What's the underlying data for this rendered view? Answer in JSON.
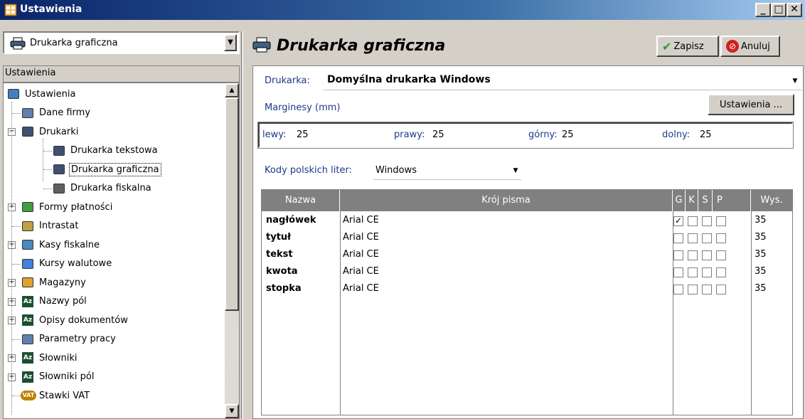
{
  "window": {
    "title": "Ustawienia",
    "min": "_",
    "max": "□",
    "close": "✕"
  },
  "left": {
    "combo_value": "Drukarka graficzna",
    "tree_header": "Ustawienia",
    "tree": [
      {
        "label": "Ustawienia",
        "icon": "tools-icon",
        "level": 0
      },
      {
        "label": "Dane firmy",
        "icon": "company-icon",
        "level": 1
      },
      {
        "label": "Drukarki",
        "icon": "printer-icon",
        "level": 1,
        "expander": "−"
      },
      {
        "label": "Drukarka tekstowa",
        "icon": "printer-icon",
        "level": 2
      },
      {
        "label": "Drukarka graficzna",
        "icon": "printer-icon",
        "level": 2,
        "selected": true
      },
      {
        "label": "Drukarka fiskalna",
        "icon": "fiscal-printer-icon",
        "level": 2
      },
      {
        "label": "Formy płatności",
        "icon": "payment-icon",
        "level": 1,
        "expander": "+"
      },
      {
        "label": "Intrastat",
        "icon": "intrastat-icon",
        "level": 1
      },
      {
        "label": "Kasy fiskalne",
        "icon": "cash-register-icon",
        "level": 1,
        "expander": "+"
      },
      {
        "label": "Kursy walutowe",
        "icon": "chart-icon",
        "level": 1
      },
      {
        "label": "Magazyny",
        "icon": "warehouse-icon",
        "level": 1,
        "expander": "+"
      },
      {
        "label": "Nazwy pól",
        "icon": "az-icon",
        "level": 1,
        "expander": "+"
      },
      {
        "label": "Opisy dokumentów",
        "icon": "az-icon",
        "level": 1,
        "expander": "+"
      },
      {
        "label": "Parametry pracy",
        "icon": "company-icon",
        "level": 1
      },
      {
        "label": "Słowniki",
        "icon": "az-icon",
        "level": 1,
        "expander": "+"
      },
      {
        "label": "Słowniki pól",
        "icon": "az-icon",
        "level": 1,
        "expander": "+"
      },
      {
        "label": "Stawki VAT",
        "icon": "vat-icon",
        "level": 1
      }
    ]
  },
  "right": {
    "title": "Drukarka graficzna",
    "save_label": "Zapisz",
    "cancel_label": "Anuluj",
    "printer_label": "Drukarka:",
    "printer_value": "Domyślna drukarka Windows",
    "margins_label": "Marginesy (mm)",
    "settings_button": "Ustawienia ...",
    "margins": {
      "left_label": "lewy:",
      "left_value": "25",
      "right_label": "prawy:",
      "right_value": "25",
      "top_label": "górny:",
      "top_value": "25",
      "bottom_label": "dolny:",
      "bottom_value": "25"
    },
    "codes_label": "Kody polskich liter:",
    "codes_value": "Windows",
    "grid": {
      "headers": {
        "name": "Nazwa",
        "font": "Krój pisma",
        "g": "G",
        "k": "K",
        "s": "S",
        "p": "P",
        "height": "Wys."
      },
      "rows": [
        {
          "name": "nagłówek",
          "font": "Arial CE",
          "g": true,
          "k": false,
          "s": false,
          "p": false,
          "height": "35"
        },
        {
          "name": "tytuł",
          "font": "Arial CE",
          "g": false,
          "k": false,
          "s": false,
          "p": false,
          "height": "35"
        },
        {
          "name": "tekst",
          "font": "Arial CE",
          "g": false,
          "k": false,
          "s": false,
          "p": false,
          "height": "35"
        },
        {
          "name": "kwota",
          "font": "Arial CE",
          "g": false,
          "k": false,
          "s": false,
          "p": false,
          "height": "35"
        },
        {
          "name": "stopka",
          "font": "Arial CE",
          "g": false,
          "k": false,
          "s": false,
          "p": false,
          "height": "35"
        }
      ]
    }
  }
}
